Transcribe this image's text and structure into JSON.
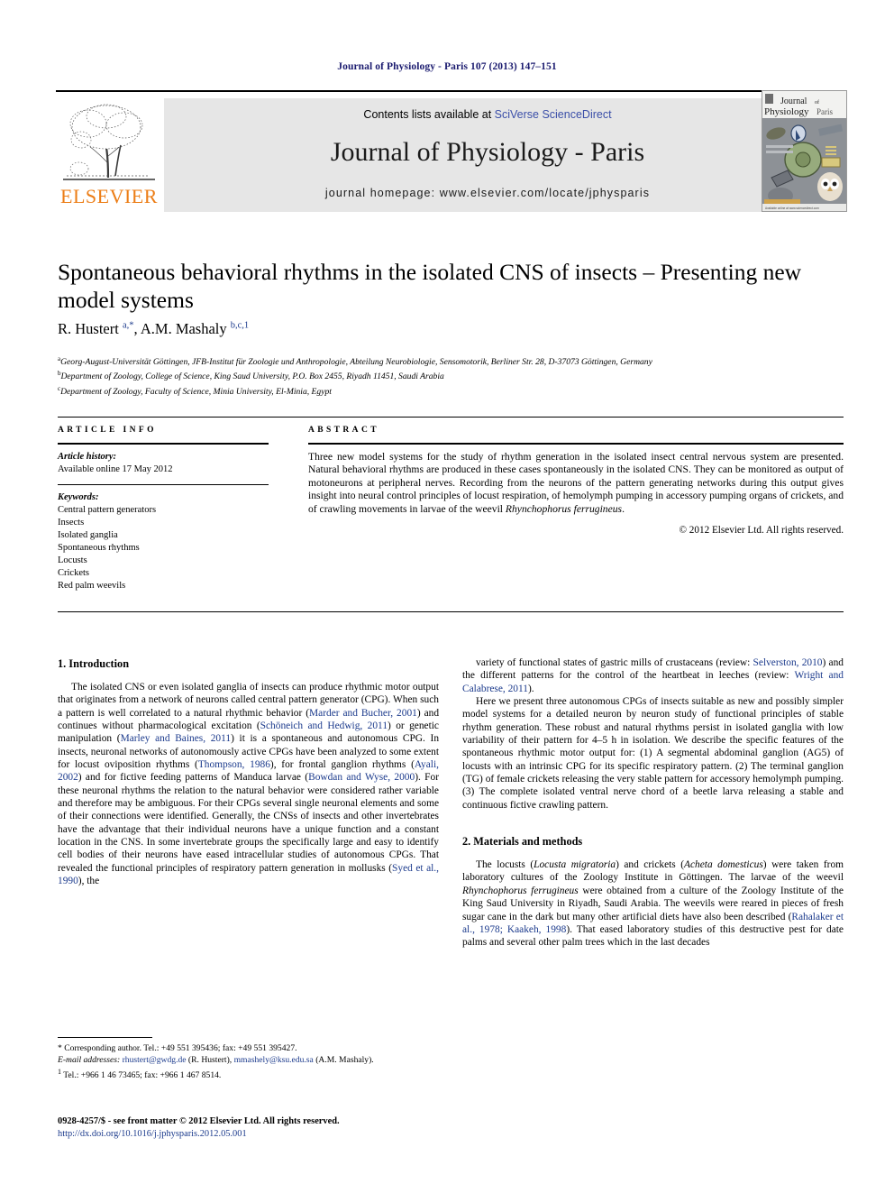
{
  "running_head": "Journal of Physiology - Paris 107 (2013) 147–151",
  "masthead": {
    "contents_prefix": "Contents lists available at ",
    "contents_link": "SciVerse ScienceDirect",
    "journal_title": "Journal of Physiology - Paris",
    "homepage": "journal homepage: www.elsevier.com/locate/jphysparis",
    "publisher_logo_text": "ELSEVIER",
    "cover_line1": "Journal of",
    "cover_line2": "Physiology Paris"
  },
  "article": {
    "title": "Spontaneous behavioral rhythms in the isolated CNS of insects – Presenting new model systems",
    "authors_html": "R. Hustert <sup>a,*</sup>, A.M. Mashaly <sup>b,c,1</sup>",
    "affiliations": [
      {
        "marker": "a",
        "text": "Georg-August-Universität Göttingen, JFB-Institut für Zoologie und Anthropologie, Abteilung Neurobiologie, Sensomotorik, Berliner Str. 28, D-37073 Göttingen, Germany"
      },
      {
        "marker": "b",
        "text": "Department of Zoology, College of Science, King Saud University, P.O. Box 2455, Riyadh 11451, Saudi Arabia"
      },
      {
        "marker": "c",
        "text": "Department of Zoology, Faculty of Science, Minia University, El-Minia, Egypt"
      }
    ]
  },
  "article_info": {
    "heading": "ARTICLE INFO",
    "history_label": "Article history:",
    "history_value": "Available online 17 May 2012",
    "keywords_label": "Keywords:",
    "keywords": [
      "Central pattern generators",
      "Insects",
      "Isolated ganglia",
      "Spontaneous rhythms",
      "Locusts",
      "Crickets",
      "Red palm weevils"
    ]
  },
  "abstract": {
    "heading": "ABSTRACT",
    "text_html": "Three new model systems for the study of rhythm generation in the isolated insect central nervous system are presented. Natural behavioral rhythms are produced in these cases spontaneously in the isolated CNS. They can be monitored as output of motoneurons at peripheral nerves. Recording from the neurons of the pattern generating networks during this output gives insight into neural control principles of locust respiration, of hemolymph pumping in accessory pumping organs of crickets, and of crawling movements in larvae of the weevil <i>Rhynchophorus ferrugineus</i>.",
    "copyright": "© 2012 Elsevier Ltd. All rights reserved."
  },
  "body": {
    "intro_heading": "1. Introduction",
    "intro_p1_html": "The isolated CNS or even isolated ganglia of insects can produce rhythmic motor output that originates from a network of neurons called central pattern generator (CPG). When such a pattern is well correlated to a natural rhythmic behavior (<span class=\"ref\">Marder and Bucher, 2001</span>) and continues without pharmacological excitation (<span class=\"ref\">Schöneich and Hedwig, 2011</span>) or genetic manipulation (<span class=\"ref\">Marley and Baines, 2011</span>) it is a spontaneous and autonomous CPG. In insects, neuronal networks of autonomously active CPGs have been analyzed to some extent for locust oviposition rhythms (<span class=\"ref\">Thompson, 1986</span>), for frontal ganglion rhythms (<span class=\"ref\">Ayali, 2002</span>) and for fictive feeding patterns of Manduca larvae (<span class=\"ref\">Bowdan and Wyse, 2000</span>). For these neuronal rhythms the relation to the natural behavior were considered rather variable and therefore may be ambiguous. For their CPGs several single neuronal elements and some of their connections were identified. Generally, the CNSs of insects and other invertebrates have the advantage that their individual neurons have a unique function and a constant location in the CNS. In some invertebrate groups the specifically large and easy to identify cell bodies of their neurons have eased intracellular studies of autonomous CPGs. That revealed the functional principles of respiratory pattern generation in mollusks (<span class=\"ref\">Syed et al., 1990</span>), the",
    "right_p1_html": "variety of functional states of gastric mills of crustaceans (review: <span class=\"ref\">Selverston, 2010</span>) and the different patterns for the control of the heartbeat in leeches (review: <span class=\"ref\">Wright and Calabrese, 2011</span>).",
    "right_p2_html": "Here we present three autonomous CPGs of insects suitable as new and possibly simpler model systems for a detailed neuron by neuron study of functional principles of stable rhythm generation. These robust and natural rhythms persist in isolated ganglia with low variability of their pattern for 4–5 h in isolation. We describe the specific features of the spontaneous rhythmic motor output for: (1) A segmental abdominal ganglion (AG5) of locusts with an intrinsic CPG for its specific respiratory pattern. (2) The terminal ganglion (TG) of female crickets releasing the very stable pattern for accessory hemolymph pumping. (3) The complete isolated ventral nerve chord of a beetle larva releasing a stable and continuous fictive crawling pattern.",
    "methods_heading": "2. Materials and methods",
    "methods_p1_html": "The locusts (<span class=\"ital\">Locusta migratoria</span>) and crickets (<span class=\"ital\">Acheta domesticus</span>) were taken from laboratory cultures of the Zoology Institute in Göttingen. The larvae of the weevil <span class=\"ital\">Rhynchophorus ferrugineus</span> were obtained from a culture of the Zoology Institute of the King Saud University in Riyadh, Saudi Arabia. The weevils were reared in pieces of fresh sugar cane in the dark but many other artificial diets have also been described (<span class=\"ref\">Rahalaker et al., 1978; Kaakeh, 1998</span>). That eased laboratory studies of this destructive pest for date palms and several other palm trees which in the last decades"
  },
  "footnotes": {
    "corresponding_html": "<span class=\"fn-sym\">*</span> Corresponding author. Tel.: +49 551 395436; fax: +49 551 395427.",
    "emails_html": "<span class=\"fn-em\">E-mail addresses:</span> <span class=\"mail\">rhustert@gwdg.de</span> (R. Hustert), <span class=\"mail\">mmashely@ksu.edu.sa</span> (A.M. Mashaly).",
    "note1_html": "<sup>1</sup> Tel.: +966 1 46 73465; fax: +966 1 467 8514."
  },
  "bottom_matter": {
    "issn_line": "0928-4257/$ - see front matter © 2012 Elsevier Ltd. All rights reserved.",
    "doi": "http://dx.doi.org/10.1016/j.jphysparis.2012.05.001"
  },
  "colors": {
    "link_blue": "#3a4ea8",
    "ref_blue": "#1b3a8c",
    "head_blue": "#1b1b6f",
    "elsevier_orange": "#ec7d16",
    "banner_gray": "#e6e6e6"
  }
}
